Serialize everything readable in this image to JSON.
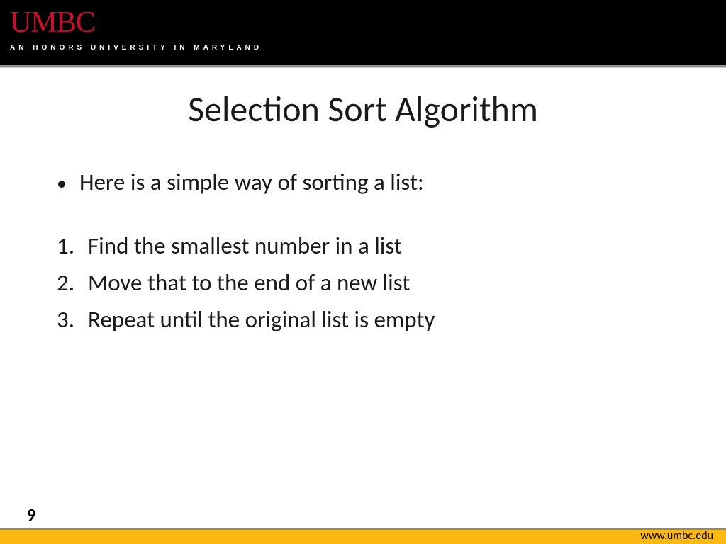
{
  "header": {
    "logo": "UMBC",
    "tagline": "AN HONORS UNIVERSITY IN MARYLAND"
  },
  "slide": {
    "title": "Selection Sort Algorithm",
    "intro": "Here is a simple way of sorting a list:",
    "steps": [
      {
        "num": "1.",
        "text": "Find the smallest number in a list"
      },
      {
        "num": "2.",
        "text": "Move that to the end of a new list"
      },
      {
        "num": "3.",
        "text": "Repeat until the original list is empty"
      }
    ]
  },
  "footer": {
    "page": "9",
    "url": "www.umbc.edu"
  }
}
